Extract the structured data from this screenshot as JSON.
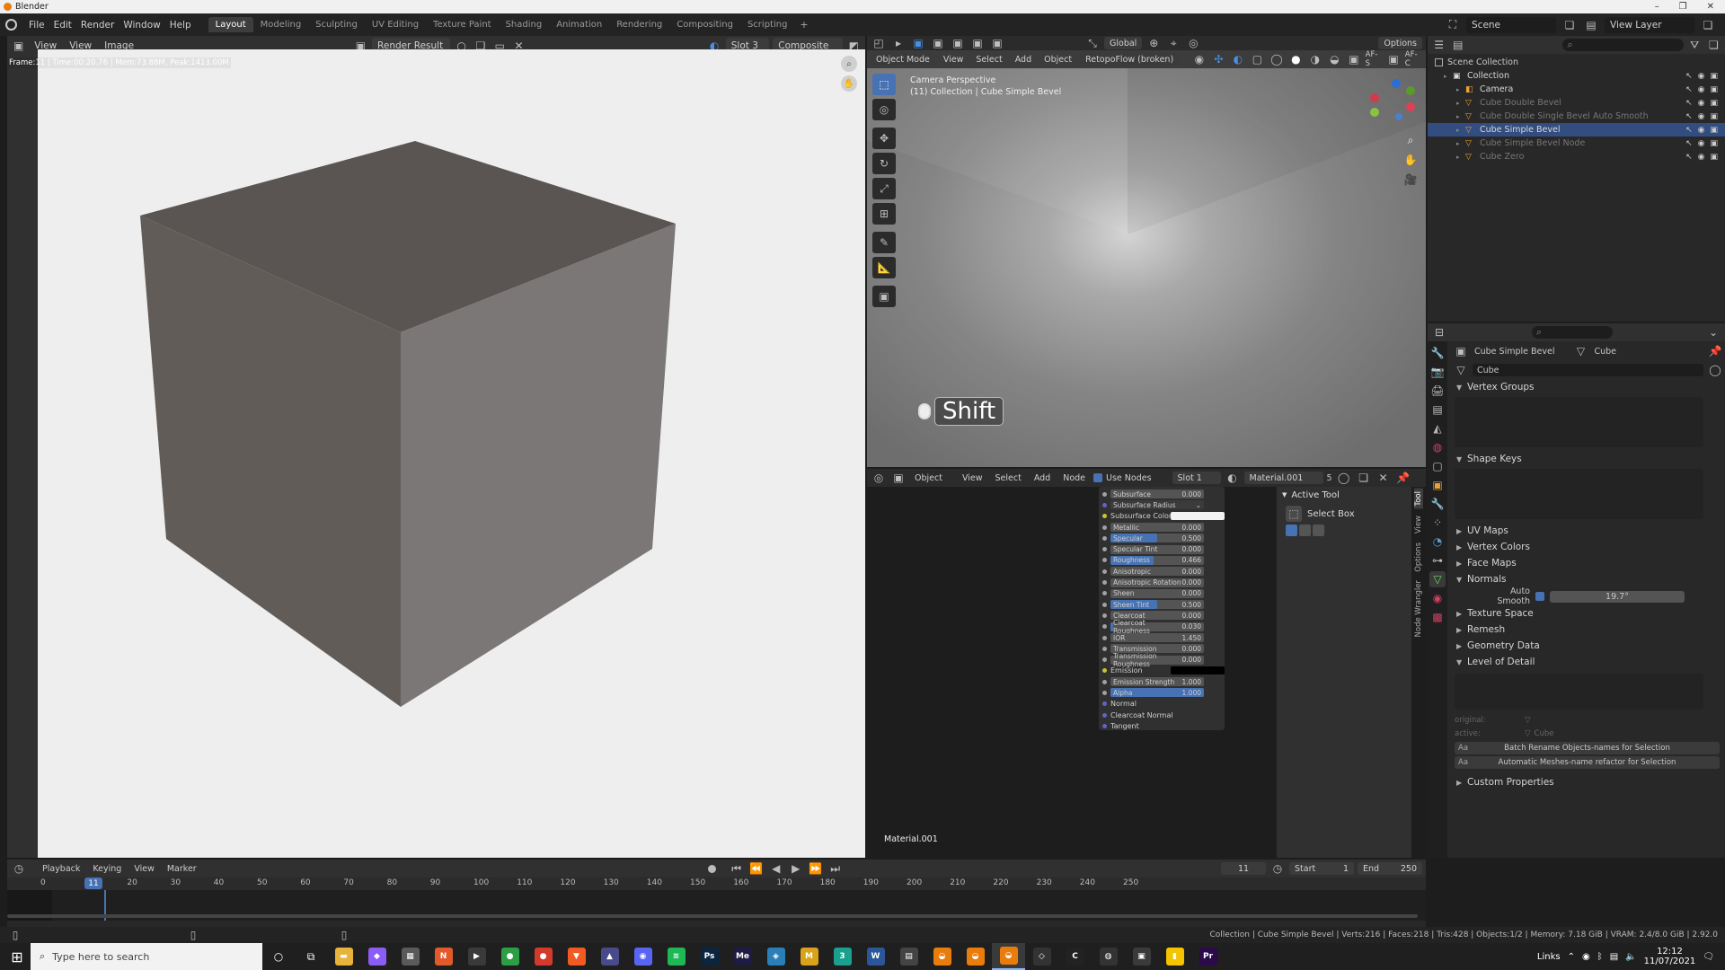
{
  "app": {
    "title": "Blender"
  },
  "menubar": {
    "menus": [
      "File",
      "Edit",
      "Render",
      "Window",
      "Help"
    ],
    "workspaces": [
      "Layout",
      "Modeling",
      "Sculpting",
      "UV Editing",
      "Texture Paint",
      "Shading",
      "Animation",
      "Rendering",
      "Compositing",
      "Scripting"
    ],
    "active_workspace": "Layout",
    "add_tab": "+",
    "scene": "Scene",
    "view_layer": "View Layer"
  },
  "image_editor": {
    "menus": [
      "View",
      "View",
      "Image"
    ],
    "image_name": "Render Result",
    "slot": "Slot 3",
    "pass": "Composite",
    "frame_info": "Frame:11 | Time:00:20.76 | Mem:73.88M, Peak:1413.00M"
  },
  "viewport": {
    "mode": "Object Mode",
    "menus": [
      "View",
      "Select",
      "Add",
      "Object"
    ],
    "addon_dropdown": "RetopoFlow (broken)",
    "orientation": "Global",
    "options": "Options",
    "overlay_label": "AF-S",
    "overlay_label2": "AF-C",
    "title": "Camera Perspective",
    "subtitle": "(11) Collection | Cube Simple Bevel",
    "key_hint": "Shift"
  },
  "node_editor": {
    "editor_type": "Object",
    "menus": [
      "View",
      "Select",
      "Add",
      "Node"
    ],
    "use_nodes": "Use Nodes",
    "slot": "Slot 1",
    "material": "Material.001",
    "users": "5",
    "material_label": "Material.001",
    "sockets": [
      {
        "label": "Subsurface",
        "value": "0.000",
        "fill": 0,
        "color": "#a1a1a1",
        "type": "bar"
      },
      {
        "label": "Subsurface Radius",
        "value": "",
        "fill": 0,
        "color": "#6363c7",
        "type": "dropdown"
      },
      {
        "label": "Subsurface Color",
        "value": "",
        "fill": 0,
        "color": "#c7c729",
        "type": "color",
        "swatch": "#f2f2f2"
      },
      {
        "label": "Metallic",
        "value": "0.000",
        "fill": 0,
        "color": "#a1a1a1",
        "type": "bar"
      },
      {
        "label": "Specular",
        "value": "0.500",
        "fill": 0.5,
        "color": "#a1a1a1",
        "type": "bar"
      },
      {
        "label": "Specular Tint",
        "value": "0.000",
        "fill": 0,
        "color": "#a1a1a1",
        "type": "bar"
      },
      {
        "label": "Roughness",
        "value": "0.466",
        "fill": 0.466,
        "color": "#a1a1a1",
        "type": "bar"
      },
      {
        "label": "Anisotropic",
        "value": "0.000",
        "fill": 0,
        "color": "#a1a1a1",
        "type": "bar"
      },
      {
        "label": "Anisotropic Rotation",
        "value": "0.000",
        "fill": 0,
        "color": "#a1a1a1",
        "type": "bar"
      },
      {
        "label": "Sheen",
        "value": "0.000",
        "fill": 0,
        "color": "#a1a1a1",
        "type": "bar"
      },
      {
        "label": "Sheen Tint",
        "value": "0.500",
        "fill": 0.5,
        "color": "#a1a1a1",
        "type": "bar"
      },
      {
        "label": "Clearcoat",
        "value": "0.000",
        "fill": 0,
        "color": "#a1a1a1",
        "type": "bar"
      },
      {
        "label": "Clearcoat Roughness",
        "value": "0.030",
        "fill": 0.03,
        "color": "#a1a1a1",
        "type": "bar"
      },
      {
        "label": "IOR",
        "value": "1.450",
        "fill": 0,
        "color": "#a1a1a1",
        "type": "bar"
      },
      {
        "label": "Transmission",
        "value": "0.000",
        "fill": 0,
        "color": "#a1a1a1",
        "type": "bar"
      },
      {
        "label": "Transmission Roughness",
        "value": "0.000",
        "fill": 0,
        "color": "#a1a1a1",
        "type": "bar"
      },
      {
        "label": "Emission",
        "value": "",
        "fill": 0,
        "color": "#c7c729",
        "type": "color",
        "swatch": "#000000"
      },
      {
        "label": "Emission Strength",
        "value": "1.000",
        "fill": 0,
        "color": "#a1a1a1",
        "type": "bar"
      },
      {
        "label": "Alpha",
        "value": "1.000",
        "fill": 1,
        "color": "#a1a1a1",
        "type": "bar"
      },
      {
        "label": "Normal",
        "value": "",
        "fill": 0,
        "color": "#6363c7",
        "type": "none"
      },
      {
        "label": "Clearcoat Normal",
        "value": "",
        "fill": 0,
        "color": "#6363c7",
        "type": "none"
      },
      {
        "label": "Tangent",
        "value": "",
        "fill": 0,
        "color": "#6363c7",
        "type": "none"
      }
    ],
    "sidebar_tabs": [
      "Tool",
      "View",
      "Options",
      "Node Wrangler"
    ],
    "active_tool_header": "Active Tool",
    "active_tool_name": "Select Box"
  },
  "outliner": {
    "root": "Scene Collection",
    "items": [
      {
        "label": "Collection",
        "indent": 0,
        "selected": false,
        "dim": false
      },
      {
        "label": "Camera",
        "indent": 1,
        "selected": false,
        "dim": false
      },
      {
        "label": "Cube Double Bevel",
        "indent": 1,
        "selected": false,
        "dim": true
      },
      {
        "label": "Cube Double Single Bevel Auto Smooth",
        "indent": 1,
        "selected": false,
        "dim": true
      },
      {
        "label": "Cube Simple Bevel",
        "indent": 1,
        "selected": true,
        "dim": false
      },
      {
        "label": "Cube Simple Bevel Node",
        "indent": 1,
        "selected": false,
        "dim": true
      },
      {
        "label": "Cube Zero",
        "indent": 1,
        "selected": false,
        "dim": true
      }
    ]
  },
  "properties": {
    "object_name": "Cube Simple Bevel",
    "data_name": "Cube",
    "mesh_field": "Cube",
    "sections": [
      {
        "label": "Vertex Groups",
        "open": true
      },
      {
        "label": "Shape Keys",
        "open": true
      },
      {
        "label": "UV Maps",
        "open": false
      },
      {
        "label": "Vertex Colors",
        "open": false
      },
      {
        "label": "Face Maps",
        "open": false
      },
      {
        "label": "Normals",
        "open": true
      }
    ],
    "auto_smooth_label": "Auto Smooth",
    "auto_smooth_value": "19.7°",
    "sections2": [
      {
        "label": "Texture Space",
        "open": false
      },
      {
        "label": "Remesh",
        "open": false
      },
      {
        "label": "Geometry Data",
        "open": false
      },
      {
        "label": "Level of Detail",
        "open": true
      }
    ],
    "lod_original_label": "original:",
    "lod_active_label": "active:",
    "lod_active_value": "Cube",
    "batch_rename": "Batch Rename Objects-names for Selection",
    "auto_mesh_rename": "Automatic Meshes-name refactor for Selection",
    "custom_props": "Custom Properties"
  },
  "timeline": {
    "menus": [
      "Playback",
      "Keying",
      "View",
      "Marker"
    ],
    "current_frame": "11",
    "start_label": "Start",
    "start": "1",
    "end_label": "End",
    "end": "250",
    "ticks": [
      "0",
      "20",
      "30",
      "40",
      "50",
      "60",
      "70",
      "80",
      "90",
      "100",
      "110",
      "120",
      "130",
      "140",
      "150",
      "160",
      "170",
      "180",
      "190",
      "200",
      "210",
      "220",
      "230",
      "240",
      "250"
    ]
  },
  "statusbar": {
    "text": "Collection | Cube Simple Bevel | Verts:216 | Faces:218 | Tris:428 | Objects:1/2 | Memory: 7.18 GiB | VRAM: 2.4/8.0 GiB | 2.92.0"
  },
  "taskbar": {
    "search_placeholder": "Type here to search",
    "links": "Links",
    "time": "12:12",
    "date": "11/07/2021",
    "apps": [
      {
        "icon": "folder-icon",
        "color": "#e8b33c",
        "glyph": "▬"
      },
      {
        "icon": "affinity-icon",
        "color": "#8b5cf6",
        "glyph": "◆"
      },
      {
        "icon": "calculator-icon",
        "color": "#5a5a5a",
        "glyph": "▦"
      },
      {
        "icon": "nuke-icon",
        "color": "#e25a2c",
        "glyph": "N"
      },
      {
        "icon": "cursor-icon",
        "color": "#3a3a3a",
        "glyph": "▶"
      },
      {
        "icon": "chrome-icon",
        "color": "#2c9f45",
        "glyph": "●"
      },
      {
        "icon": "chrome-alt-icon",
        "color": "#d33a2c",
        "glyph": "●"
      },
      {
        "icon": "brave-icon",
        "color": "#f15a22",
        "glyph": "▼"
      },
      {
        "icon": "rocket-icon",
        "color": "#4a4a8a",
        "glyph": "▲"
      },
      {
        "icon": "discord-icon",
        "color": "#5865f2",
        "glyph": "◉"
      },
      {
        "icon": "spotify-icon",
        "color": "#1db954",
        "glyph": "≋"
      },
      {
        "icon": "photoshop-icon",
        "color": "#0b2540",
        "glyph": "Ps"
      },
      {
        "icon": "media-encoder-icon",
        "color": "#1d1a44",
        "glyph": "Me"
      },
      {
        "icon": "app-icon",
        "color": "#2a7fb8",
        "glyph": "◈"
      },
      {
        "icon": "m-icon",
        "color": "#d9a21b",
        "glyph": "M"
      },
      {
        "icon": "s-icon",
        "color": "#1aa08c",
        "glyph": "3"
      },
      {
        "icon": "word-icon",
        "color": "#2b579a",
        "glyph": "W"
      },
      {
        "icon": "windows-app-icon",
        "color": "#444",
        "glyph": "▤"
      },
      {
        "icon": "blender-icon",
        "color": "#e87d0d",
        "glyph": "◒"
      },
      {
        "icon": "blender-icon",
        "color": "#e87d0d",
        "glyph": "◒"
      },
      {
        "icon": "blender-active-icon",
        "color": "#e87d0d",
        "glyph": "◒"
      },
      {
        "icon": "unity-icon",
        "color": "#333",
        "glyph": "◇"
      },
      {
        "icon": "c-icon",
        "color": "#222",
        "glyph": "C"
      },
      {
        "icon": "globe-icon",
        "color": "#333",
        "glyph": "◍"
      },
      {
        "icon": "store-icon",
        "color": "#3a3a3a",
        "glyph": "▣"
      },
      {
        "icon": "notes-icon",
        "color": "#f5c400",
        "glyph": "▮"
      },
      {
        "icon": "premiere-icon",
        "color": "#2a0a4a",
        "glyph": "Pr"
      }
    ]
  }
}
